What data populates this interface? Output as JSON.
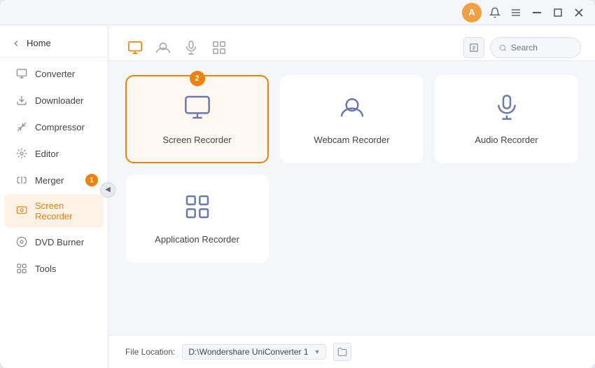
{
  "titlebar": {
    "user_initial": "A",
    "controls": [
      "notification",
      "menu",
      "minimize",
      "maximize",
      "close"
    ]
  },
  "sidebar": {
    "home_label": "Home",
    "items": [
      {
        "id": "converter",
        "label": "Converter",
        "active": false,
        "badge": null
      },
      {
        "id": "downloader",
        "label": "Downloader",
        "active": false,
        "badge": null
      },
      {
        "id": "compressor",
        "label": "Compressor",
        "active": false,
        "badge": null
      },
      {
        "id": "editor",
        "label": "Editor",
        "active": false,
        "badge": null
      },
      {
        "id": "merger",
        "label": "Merger",
        "active": false,
        "badge": "1"
      },
      {
        "id": "screen-recorder",
        "label": "Screen Recorder",
        "active": true,
        "badge": null
      },
      {
        "id": "dvd-burner",
        "label": "DVD Burner",
        "active": false,
        "badge": null
      },
      {
        "id": "tools",
        "label": "Tools",
        "active": false,
        "badge": null
      }
    ]
  },
  "toolbar": {
    "tabs": [
      {
        "id": "screen",
        "icon": "screen",
        "active": true
      },
      {
        "id": "webcam",
        "icon": "webcam",
        "active": false
      },
      {
        "id": "audio",
        "icon": "audio",
        "active": false
      },
      {
        "id": "grid",
        "icon": "grid",
        "active": false
      }
    ],
    "search_placeholder": "Search"
  },
  "recorders": [
    {
      "id": "screen-recorder",
      "label": "Screen Recorder",
      "selected": true,
      "badge": "2"
    },
    {
      "id": "webcam-recorder",
      "label": "Webcam Recorder",
      "selected": false,
      "badge": null
    },
    {
      "id": "audio-recorder",
      "label": "Audio Recorder",
      "selected": false,
      "badge": null
    },
    {
      "id": "application-recorder",
      "label": "Application Recorder",
      "selected": false,
      "badge": null
    }
  ],
  "file_location": {
    "label": "File Location:",
    "path": "D:\\Wondershare UniConverter 1",
    "dropdown_arrow": "▼"
  }
}
